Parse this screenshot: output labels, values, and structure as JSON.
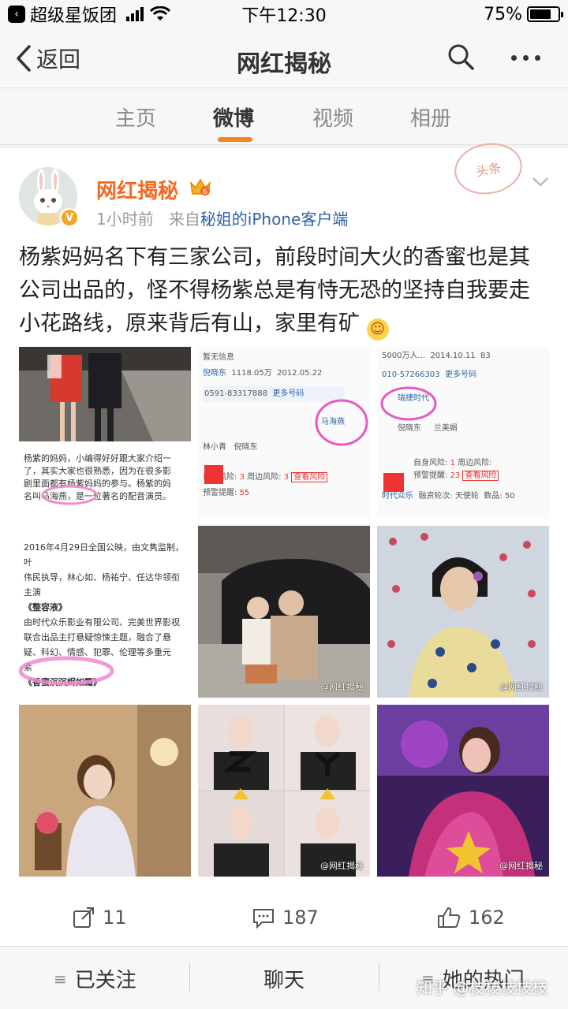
{
  "status_bar": {
    "back_app": "超级星饭团",
    "time": "下午12:30",
    "battery": "75%",
    "battery_level": 0.75
  },
  "nav": {
    "back_label": "返回",
    "title": "网红揭秘"
  },
  "tabs": [
    {
      "label": "主页"
    },
    {
      "label": "微博",
      "active": true
    },
    {
      "label": "视频"
    },
    {
      "label": "相册"
    }
  ],
  "post": {
    "author": "网红揭秘",
    "time": "1小时前",
    "source_prefix": "来自",
    "source": "秘姐的iPhone客户端",
    "stamp": "头条",
    "text": "杨紫妈妈名下有三家公司，前段时间大火的香蜜也是其公司出品的，怪不得杨紫总是有恃无恐的坚持自我要走小花路线，原来背后有山，家里有矿",
    "images": [
      {
        "doc_lines": [
          "杨紫的妈妈，小编得好好跟大家介绍一",
          "了，其实大家也很熟悉，因为在很多影",
          "剧里面都有杨紫妈妈的参与。杨紫的妈",
          "名叫马海燕，是一位著名的配音演员。"
        ]
      },
      {
        "rows": [
          "暂无信息",
          "倪晓东",
          "1118.05万",
          "2012.05.22",
          "0591-83317888",
          "更多号码",
          "马海燕",
          "倪晓东",
          "林小青",
          "自身风险:",
          "周边风险:",
          "查看风险",
          "预警提醒:"
        ]
      },
      {
        "rows": [
          "5000万人...",
          "2014.10.11",
          "83",
          "010-57266303",
          "更多号码",
          "瑞捷时代",
          "倪晓东",
          "兰美娟",
          "自身风险:",
          "周边风险:",
          "查看风险",
          "预警提醒:",
          "时代众乐",
          "融资轮次: 天使轮",
          "数品: 50"
        ]
      },
      {
        "doc_lines": [
          "2016年4月29日全国公映，由文隽监制，叶",
          "伟民执导，林心如、杨祐宁、任达华领衔",
          "主演",
          "《整容液》",
          "由时代众乐影业有限公司、完美世界影视",
          "联合出品主打悬疑惊悚主题，融合了悬",
          "疑、科幻、情感、犯罪、伦理等多重元",
          "素",
          "《香蜜沉沉烬如霜》"
        ]
      },
      {
        "watermark": "@网红揭秘"
      },
      {
        "watermark": "@网红揭秘"
      },
      {
        "watermark": ""
      },
      {
        "watermark": "@网红揭秘"
      },
      {
        "watermark": "@网红揭秘"
      }
    ]
  },
  "actions": {
    "repost": "11",
    "comment": "187",
    "like": "162"
  },
  "bottom_bar": {
    "follow": "已关注",
    "chat": "聊天",
    "hot": "她的热门",
    "watermark": "知乎 @枝枝枝枝枝"
  },
  "colors": {
    "accent": "#f5861f",
    "author": "#f26a21",
    "link": "#2f62a6"
  }
}
